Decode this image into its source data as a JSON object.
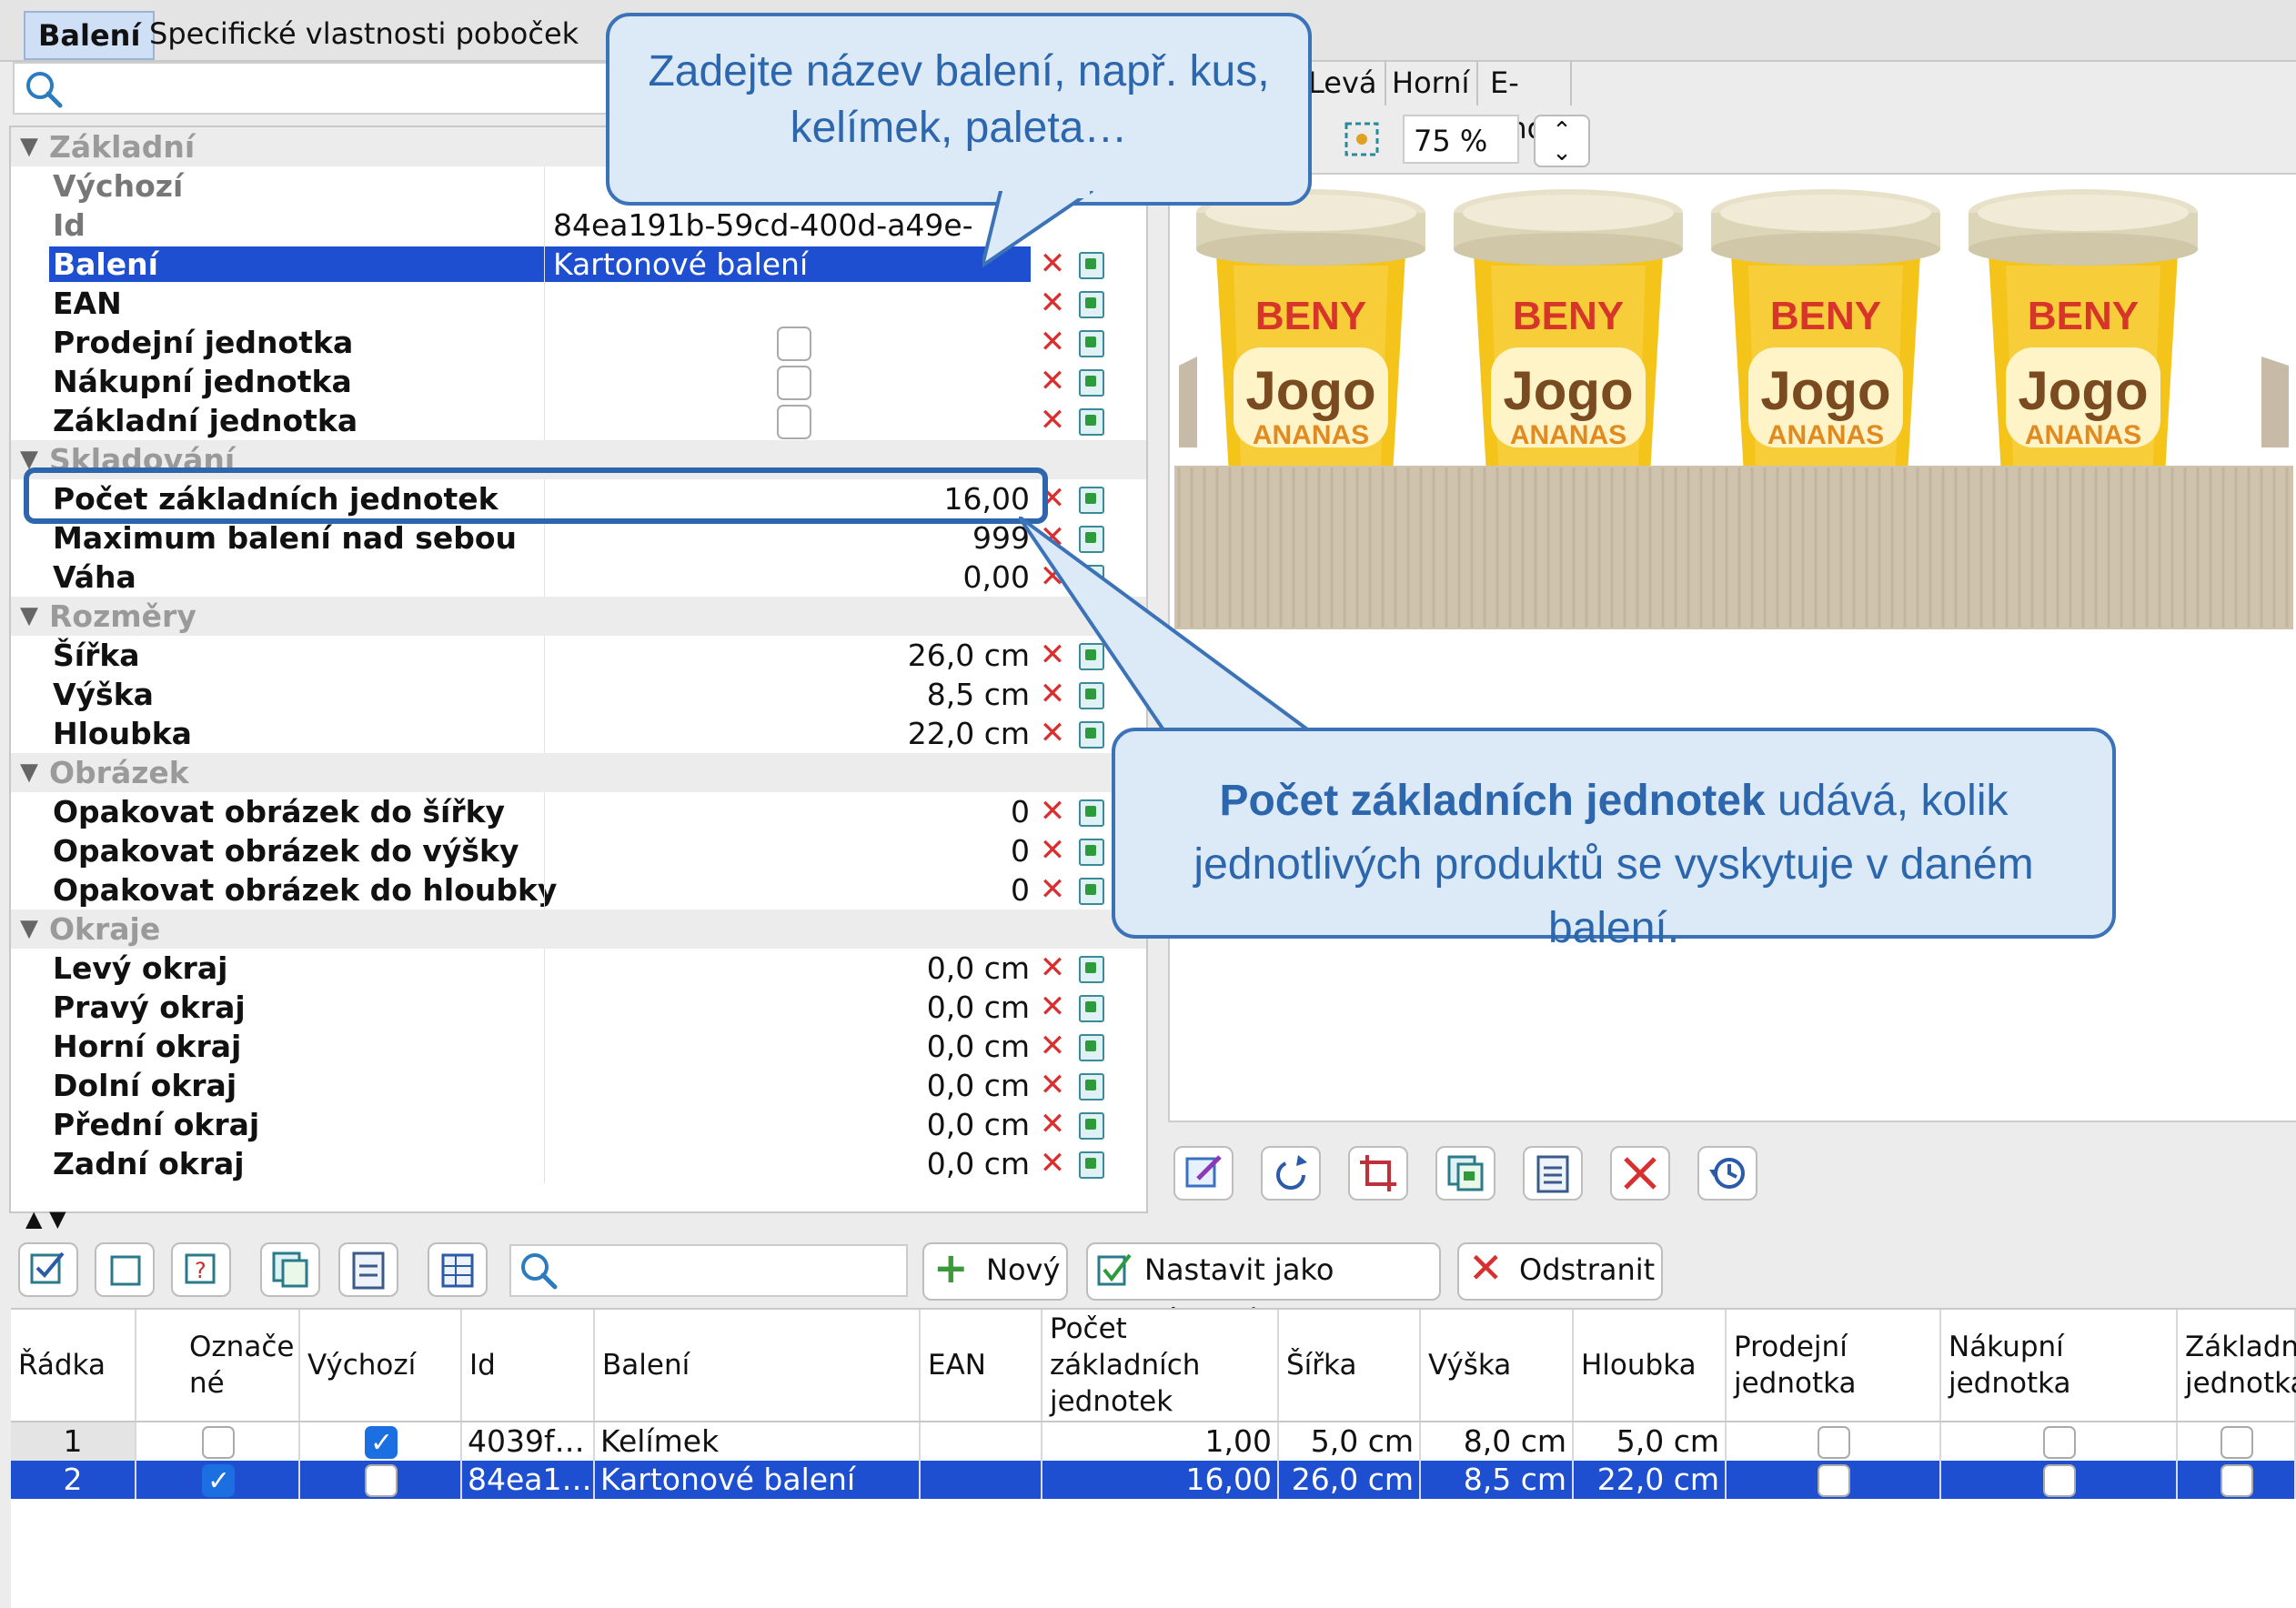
{
  "tabs": [
    "Balení",
    "Specifické vlastnosti poboček"
  ],
  "properties": {
    "rows": [
      {
        "type": "cat",
        "label": "Základní"
      },
      {
        "type": "prop",
        "label": "Výchozí",
        "value": "",
        "muted": true
      },
      {
        "type": "prop",
        "label": "Id",
        "value": "84ea191b-59cd-400d-a49e-",
        "align": "left",
        "muted": true
      },
      {
        "type": "prop",
        "label": "Balení",
        "value": "Kartonové balení",
        "align": "left",
        "selected": true,
        "actions": true
      },
      {
        "type": "prop",
        "label": "EAN",
        "value": "",
        "actions": true
      },
      {
        "type": "prop",
        "label": "Prodejní jednotka",
        "checkbox": true,
        "actions": true
      },
      {
        "type": "prop",
        "label": "Nákupní jednotka",
        "checkbox": true,
        "actions": true
      },
      {
        "type": "prop",
        "label": "Základní jednotka",
        "checkbox": true,
        "actions": true
      },
      {
        "type": "cat",
        "label": "Skladování"
      },
      {
        "type": "prop",
        "label": "Počet základních jednotek",
        "value": "16,00",
        "actions": true
      },
      {
        "type": "prop",
        "label": "Maximum balení nad sebou",
        "value": "999",
        "actions": true
      },
      {
        "type": "prop",
        "label": "Váha",
        "value": "0,00",
        "actions": true
      },
      {
        "type": "cat",
        "label": "Rozměry"
      },
      {
        "type": "prop",
        "label": "Šířka",
        "value": "26,0 cm",
        "actions": true
      },
      {
        "type": "prop",
        "label": "Výška",
        "value": "8,5 cm",
        "actions": true
      },
      {
        "type": "prop",
        "label": "Hloubka",
        "value": "22,0 cm",
        "actions": true
      },
      {
        "type": "cat",
        "label": "Obrázek"
      },
      {
        "type": "prop",
        "label": "Opakovat obrázek do šířky",
        "value": "0",
        "actions": true
      },
      {
        "type": "prop",
        "label": "Opakovat obrázek do výšky",
        "value": "0",
        "actions": true
      },
      {
        "type": "prop",
        "label": "Opakovat obrázek do hloubky",
        "value": "0",
        "actions": true
      },
      {
        "type": "cat",
        "label": "Okraje"
      },
      {
        "type": "prop",
        "label": "Levý okraj",
        "value": "0,0 cm",
        "actions": true
      },
      {
        "type": "prop",
        "label": "Pravý okraj",
        "value": "0,0 cm",
        "actions": true
      },
      {
        "type": "prop",
        "label": "Horní okraj",
        "value": "0,0 cm",
        "actions": true
      },
      {
        "type": "prop",
        "label": "Dolní okraj",
        "value": "0,0 cm",
        "actions": true
      },
      {
        "type": "prop",
        "label": "Přední okraj",
        "value": "0,0 cm",
        "actions": true
      },
      {
        "type": "prop",
        "label": "Zadní okraj",
        "value": "0,0 cm",
        "actions": true
      }
    ]
  },
  "preview": {
    "tabs": [
      "Levá",
      "Horní",
      "E-Shop"
    ],
    "zoom": "75 %",
    "product": {
      "brand": "BENY",
      "name": "Jogo",
      "flavor": "ANANAS",
      "count": 4
    }
  },
  "toolbar": {
    "new_label": "Nový",
    "set_default_label": "Nastavit jako výchozí",
    "remove_label": "Odstranit"
  },
  "table": {
    "headers": [
      "Řádka",
      "Označené",
      "Výchozí",
      "Id",
      "Balení",
      "EAN",
      "Počet základních jednotek",
      "Šířka",
      "Výška",
      "Hloubka",
      "Prodejní jednotka",
      "Nákupní jednotka",
      "Základní jednotka"
    ],
    "marked_header": "Označe né",
    "rows": [
      {
        "n": "1",
        "marked": false,
        "default": true,
        "id": "4039f…",
        "baleni": "Kelímek",
        "ean": "",
        "count": "1,00",
        "w": "5,0 cm",
        "h": "8,0 cm",
        "d": "5,0 cm",
        "selected": false
      },
      {
        "n": "2",
        "marked": true,
        "default": false,
        "id": "84ea1…",
        "baleni": "Kartonové balení",
        "ean": "",
        "count": "16,00",
        "w": "26,0 cm",
        "h": "8,5 cm",
        "d": "22,0 cm",
        "selected": true
      }
    ]
  },
  "callouts": {
    "name": "Zadejte název balení, např. kus, kelímek, paleta…",
    "count_bold": "Počet základních jednotek",
    "count_rest": " udává, kolik jednotlivých produktů se vyskytuje v daném balení."
  }
}
